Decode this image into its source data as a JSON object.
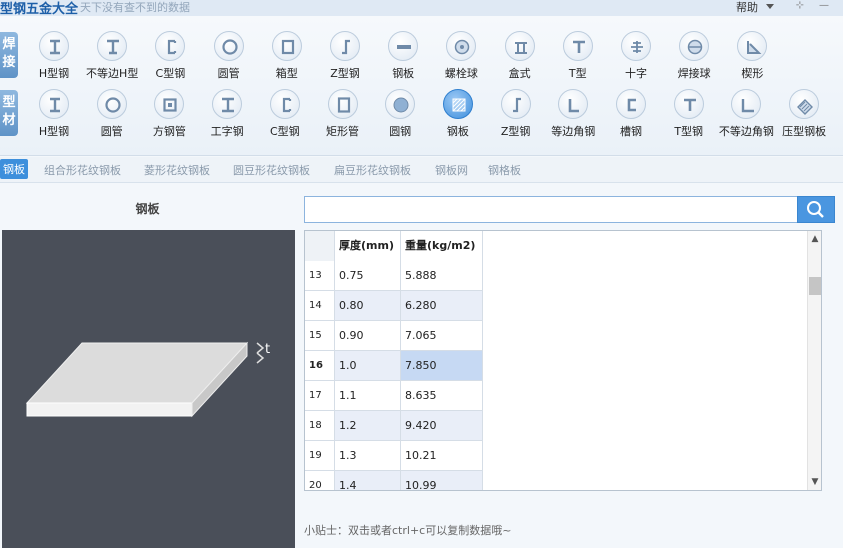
{
  "app": {
    "title": "型钢五金大全",
    "slogan": "天下没有查不到的数据",
    "help_menu": "帮助",
    "pin_icon": "⊹",
    "minimize_icon": "—"
  },
  "categories": {
    "weld": "焊 接",
    "profile": "型 材"
  },
  "toolbar_row1": [
    {
      "label": "H型钢",
      "icon": "h-beam"
    },
    {
      "label": "不等边H型",
      "icon": "unequal-h-beam"
    },
    {
      "label": "C型钢",
      "icon": "c-channel"
    },
    {
      "label": "圆管",
      "icon": "round-tube"
    },
    {
      "label": "箱型",
      "icon": "box-section"
    },
    {
      "label": "Z型钢",
      "icon": "z-section"
    },
    {
      "label": "钢板",
      "icon": "plate"
    },
    {
      "label": "螺栓球",
      "icon": "bolt-ball"
    },
    {
      "label": "盒式",
      "icon": "box-type"
    },
    {
      "label": "T型",
      "icon": "t-section"
    },
    {
      "label": "十字",
      "icon": "cross-section"
    },
    {
      "label": "焊接球",
      "icon": "welded-ball"
    },
    {
      "label": "楔形",
      "icon": "wedge"
    }
  ],
  "toolbar_row2": [
    {
      "label": "H型钢",
      "icon": "h-beam"
    },
    {
      "label": "圆管",
      "icon": "round-tube"
    },
    {
      "label": "方钢管",
      "icon": "square-tube"
    },
    {
      "label": "工字钢",
      "icon": "i-beam"
    },
    {
      "label": "C型钢",
      "icon": "c-channel"
    },
    {
      "label": "矩形管",
      "icon": "rect-tube"
    },
    {
      "label": "圆钢",
      "icon": "round-bar"
    },
    {
      "label": "钢板",
      "icon": "plate",
      "active": true
    },
    {
      "label": "Z型钢",
      "icon": "z-section"
    },
    {
      "label": "等边角钢",
      "icon": "equal-angle"
    },
    {
      "label": "槽钢",
      "icon": "channel"
    },
    {
      "label": "T型钢",
      "icon": "t-section"
    },
    {
      "label": "不等边角钢",
      "icon": "unequal-angle"
    },
    {
      "label": "压型钢板",
      "icon": "profiled-sheet"
    }
  ],
  "subtabs": [
    "钢板",
    "组合形花纹钢板",
    "菱形花纹钢板",
    "圆豆形花纹钢板",
    "扁豆形花纹钢板",
    "钢板网",
    "钢格板"
  ],
  "panel": {
    "title": "钢板",
    "dimension_label": "t"
  },
  "search": {
    "value": "",
    "icon": "search-icon"
  },
  "table": {
    "headers": [
      "",
      "厚度(mm)",
      "重量(kg/m2)"
    ],
    "selected_row": "16",
    "rows": [
      {
        "n": "13",
        "thickness": "0.75",
        "weight": "5.888"
      },
      {
        "n": "14",
        "thickness": "0.80",
        "weight": "6.280"
      },
      {
        "n": "15",
        "thickness": "0.90",
        "weight": "7.065"
      },
      {
        "n": "16",
        "thickness": "1.0",
        "weight": "7.850"
      },
      {
        "n": "17",
        "thickness": "1.1",
        "weight": "8.635"
      },
      {
        "n": "18",
        "thickness": "1.2",
        "weight": "9.420"
      },
      {
        "n": "19",
        "thickness": "1.3",
        "weight": "10.21"
      },
      {
        "n": "20",
        "thickness": "1.4",
        "weight": "10.99"
      }
    ]
  },
  "tip": "小贴士：双击或者ctrl+c可以复制数据哦~",
  "colors": {
    "accent": "#3d8fdc",
    "selected_cell": "#c6d9f3",
    "figure_bg": "#4a4f59"
  }
}
